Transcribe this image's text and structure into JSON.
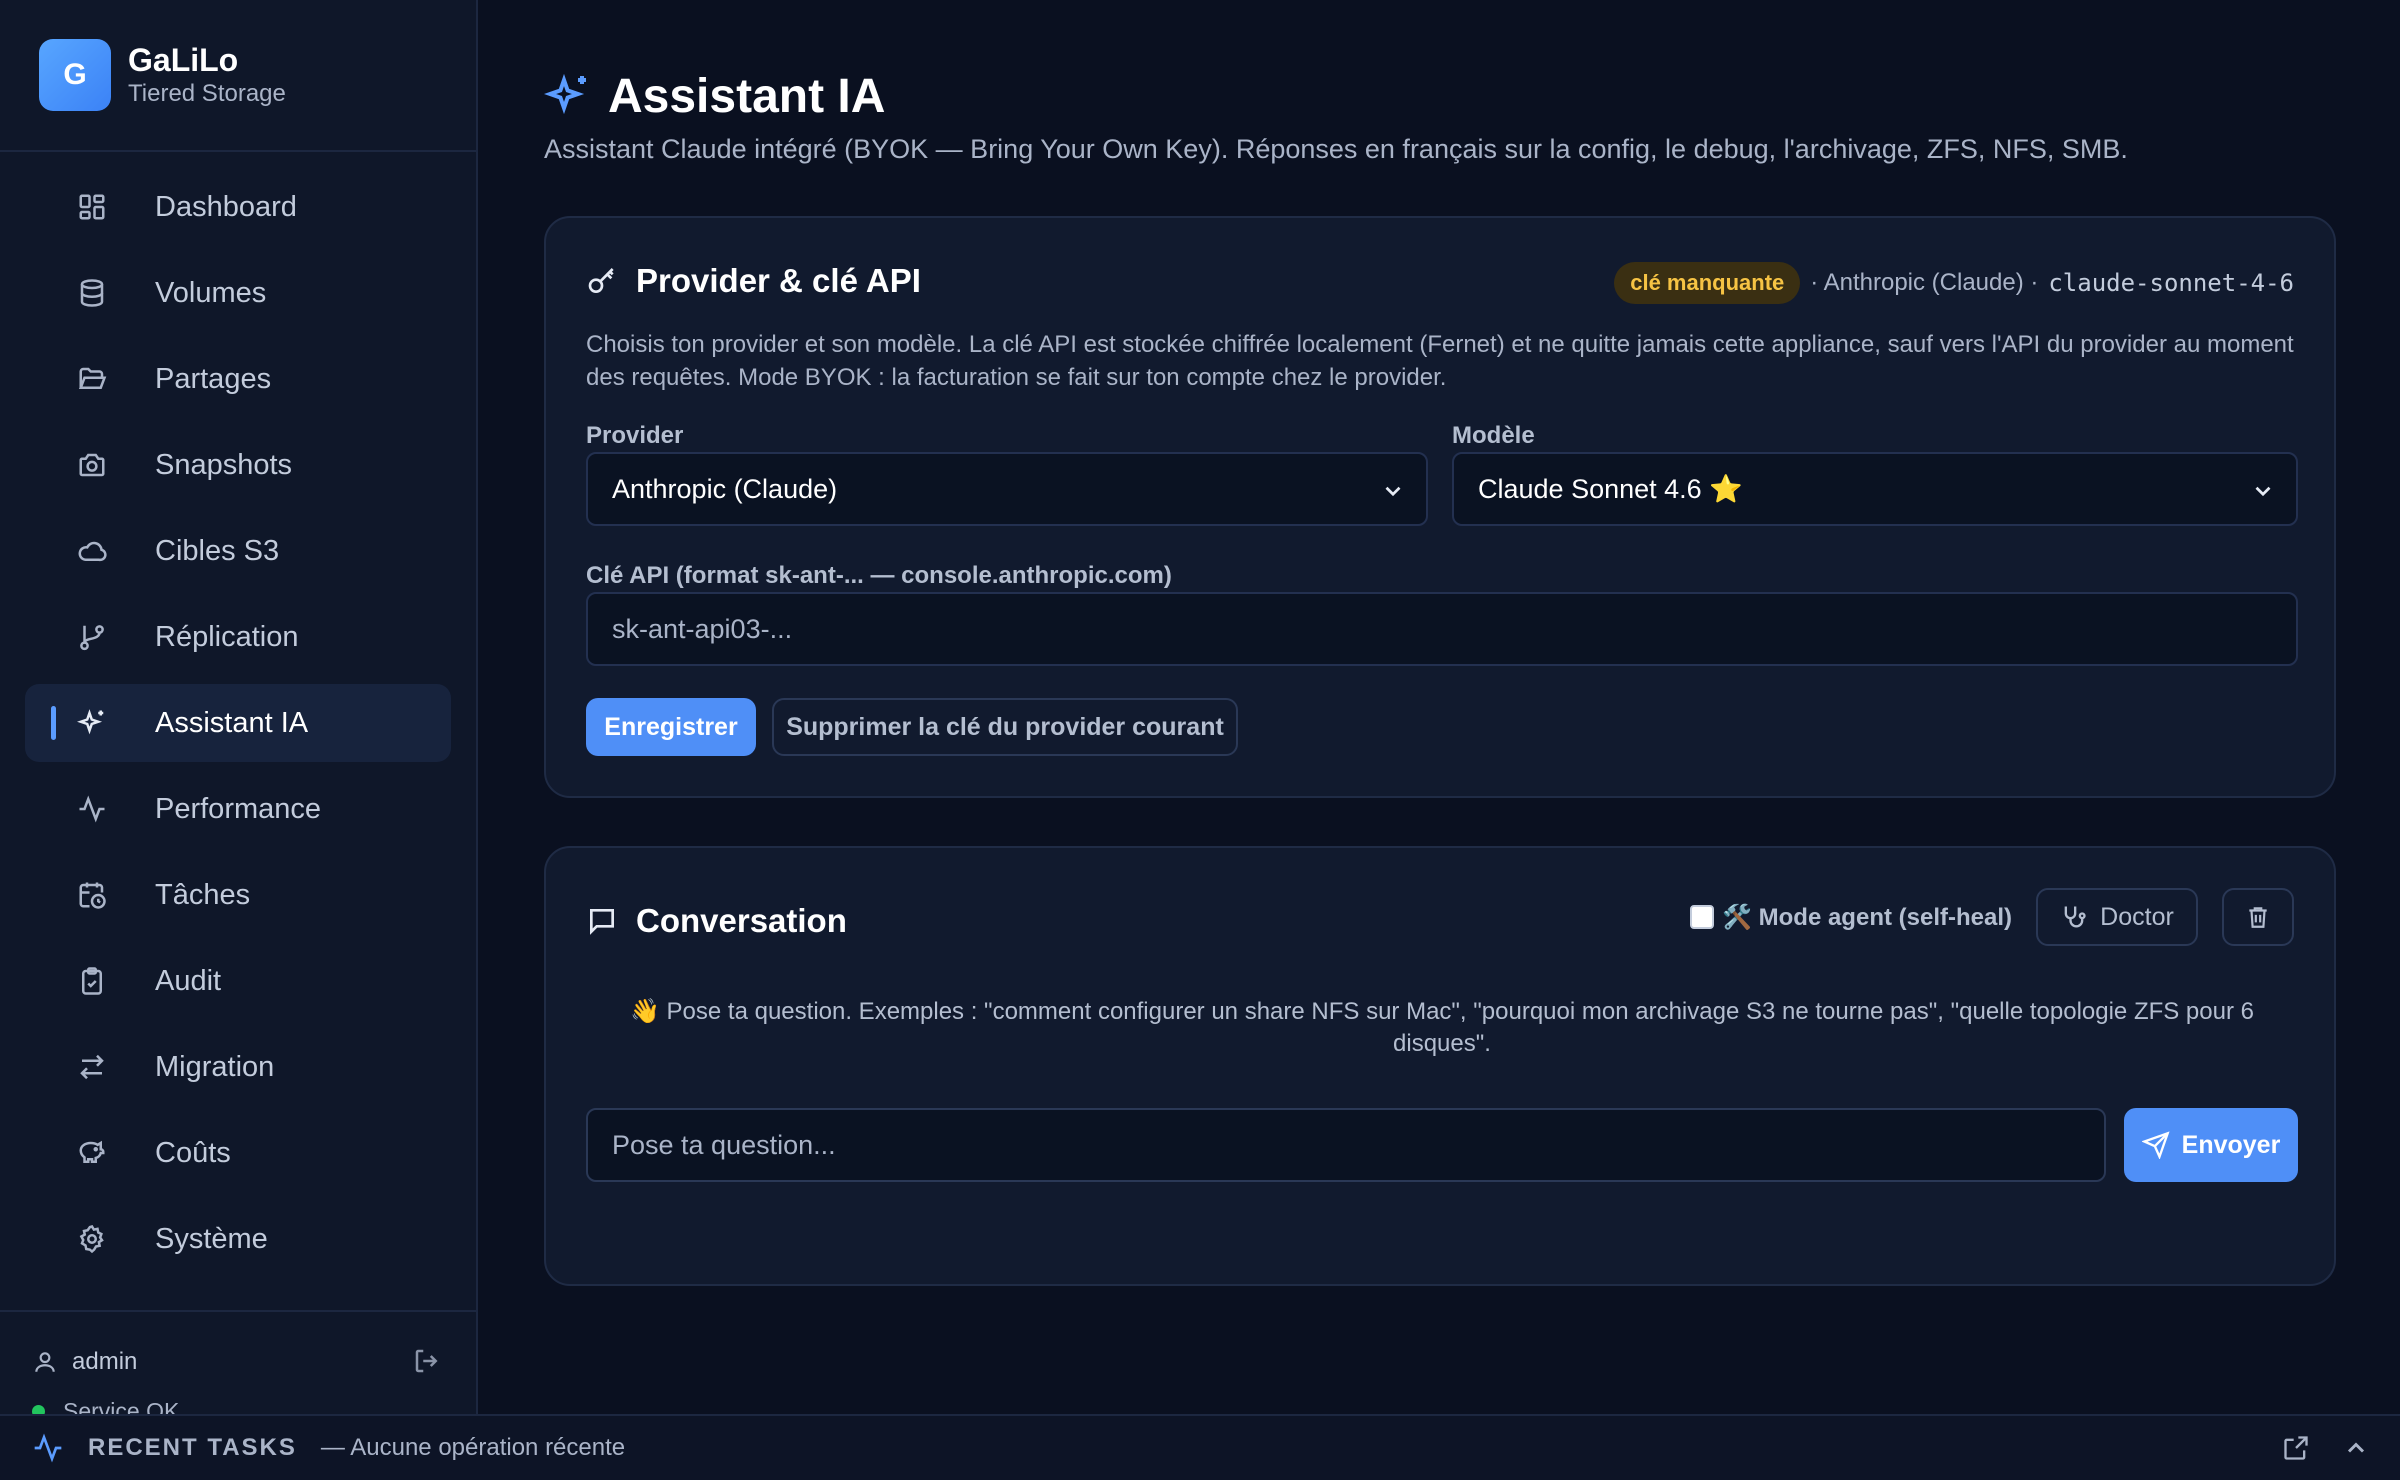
{
  "brand": {
    "logo_letter": "G",
    "name": "GaLiLo",
    "subtitle": "Tiered Storage"
  },
  "sidebar": {
    "items": [
      {
        "label": "Dashboard",
        "icon": "grid-icon"
      },
      {
        "label": "Volumes",
        "icon": "database-icon"
      },
      {
        "label": "Partages",
        "icon": "folder-open-icon"
      },
      {
        "label": "Snapshots",
        "icon": "camera-icon"
      },
      {
        "label": "Cibles S3",
        "icon": "cloud-icon"
      },
      {
        "label": "Réplication",
        "icon": "git-branch-icon"
      },
      {
        "label": "Assistant IA",
        "icon": "sparkles-icon",
        "active": true
      },
      {
        "label": "Performance",
        "icon": "activity-icon"
      },
      {
        "label": "Tâches",
        "icon": "calendar-clock-icon"
      },
      {
        "label": "Audit",
        "icon": "clipboard-check-icon"
      },
      {
        "label": "Migration",
        "icon": "arrows-swap-icon"
      },
      {
        "label": "Coûts",
        "icon": "piggy-bank-icon"
      },
      {
        "label": "Système",
        "icon": "gear-icon"
      }
    ],
    "user": "admin",
    "service_status": "Service OK"
  },
  "page": {
    "title": "Assistant IA",
    "subtitle": "Assistant Claude intégré (BYOK — Bring Your Own Key). Réponses en français sur la config, le debug, l'archivage, ZFS, NFS, SMB."
  },
  "provider_card": {
    "title": "Provider & clé API",
    "badge": "clé manquante",
    "provider_info": "· Anthropic (Claude) ·",
    "model_id": "claude-sonnet-4-6",
    "description": "Choisis ton provider et son modèle. La clé API est stockée chiffrée localement (Fernet) et ne quitte jamais cette appliance, sauf vers l'API du provider au moment des requêtes. Mode BYOK : la facturation se fait sur ton compte chez le provider.",
    "provider_label": "Provider",
    "provider_value": "Anthropic (Claude)",
    "model_label": "Modèle",
    "model_value": "Claude Sonnet 4.6 ⭐",
    "key_label": "Clé API (format sk-ant-... — console.anthropic.com)",
    "key_placeholder": "sk-ant-api03-...",
    "save_label": "Enregistrer",
    "delete_label": "Supprimer la clé du provider courant"
  },
  "conversation": {
    "title": "Conversation",
    "agent_mode_label": "🛠️ Mode agent (self-heal)",
    "doctor_label": "Doctor",
    "hint": "👋 Pose ta question. Exemples : \"comment configurer un share NFS sur Mac\", \"pourquoi mon archivage S3 ne tourne pas\", \"quelle topologie ZFS pour 6 disques\".",
    "input_placeholder": "Pose ta question...",
    "send_label": "Envoyer"
  },
  "bottombar": {
    "title": "RECENT TASKS",
    "message": "— Aucune opération récente"
  },
  "colors": {
    "background": "#0a1020",
    "sidebar": "#0f1729",
    "card": "#111a2e",
    "accent": "#4f8ff7",
    "warning_badge": "#f6c344",
    "status_ok": "#22c55e"
  }
}
